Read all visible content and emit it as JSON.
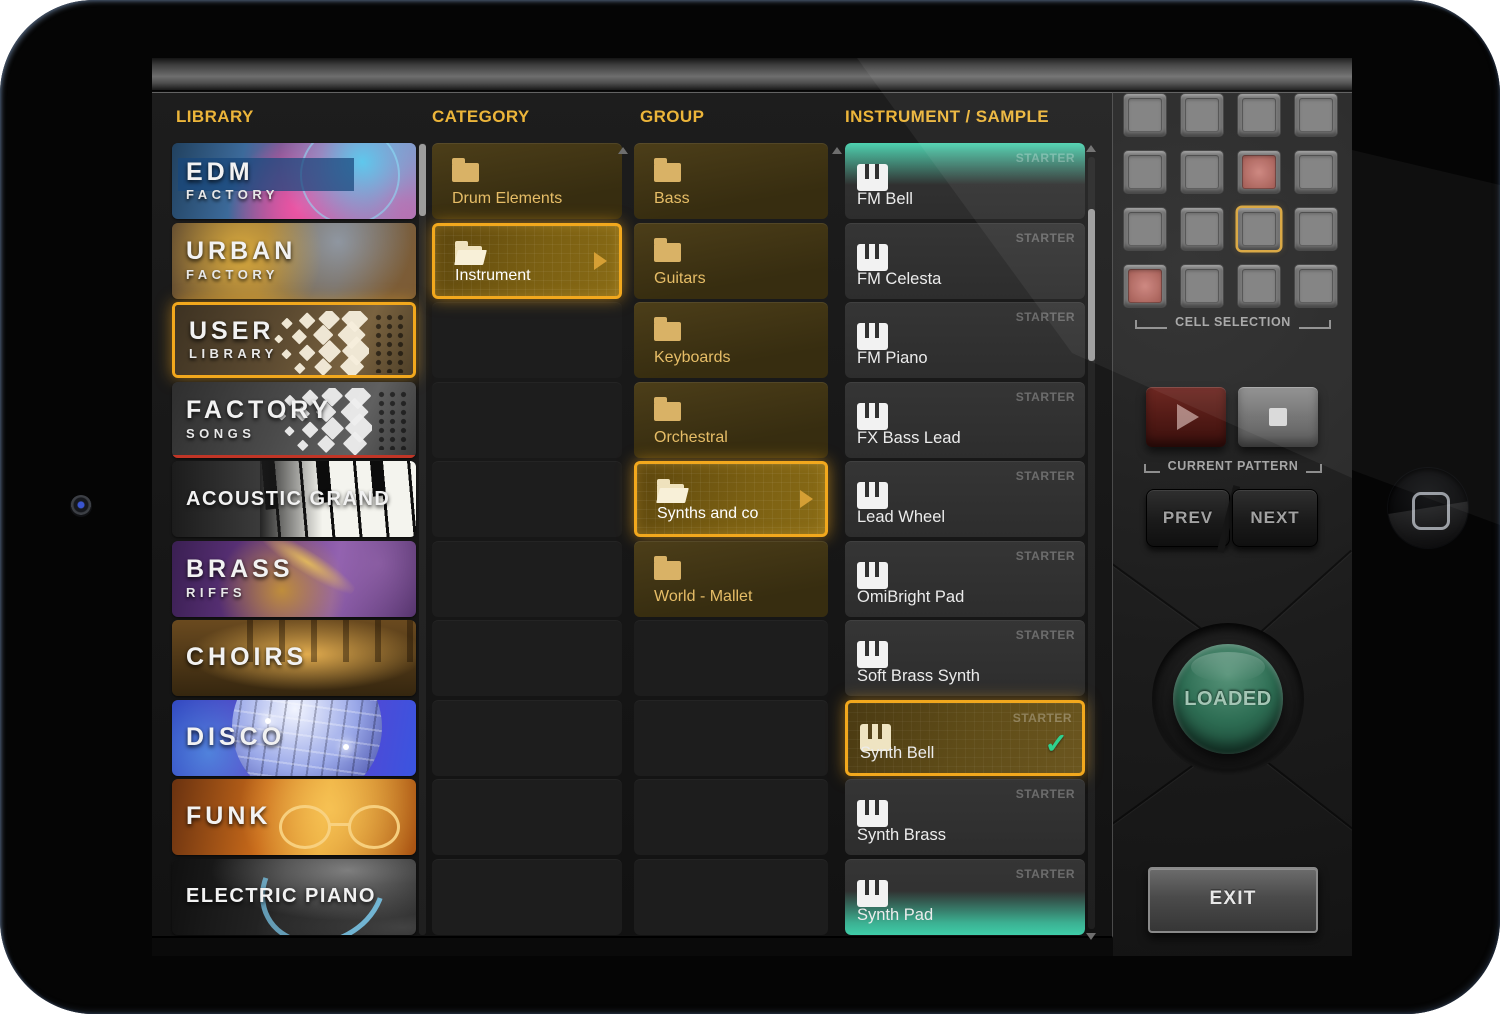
{
  "colors": {
    "accent_gold": "#ecb53a",
    "selection_orange": "#f2a81d",
    "teal_edge": "#4fd6b3",
    "check_green": "#2fd08e",
    "pad_red": "#a45a52"
  },
  "browser": {
    "library": {
      "header": "LIBRARY",
      "items": [
        {
          "title": "EDM",
          "subtitle": "FACTORY",
          "selected": false
        },
        {
          "title": "URBAN",
          "subtitle": "FACTORY",
          "selected": false
        },
        {
          "title": "USER",
          "subtitle": "LIBRARY",
          "selected": true
        },
        {
          "title": "FACTORY",
          "subtitle": "SONGS",
          "selected": false
        },
        {
          "title": "ACOUSTIC GRAND",
          "selected": false
        },
        {
          "title": "BRASS",
          "subtitle": "RIFFS",
          "selected": false
        },
        {
          "title": "CHOIRS",
          "selected": false
        },
        {
          "title": "DISCO",
          "selected": false
        },
        {
          "title": "FUNK",
          "selected": false
        },
        {
          "title": "ELECTRIC PIANO",
          "selected": false
        }
      ]
    },
    "category": {
      "header": "CATEGORY",
      "items": [
        {
          "label": "Drum Elements",
          "selected": false
        },
        {
          "label": "Instrument",
          "selected": true
        }
      ]
    },
    "group": {
      "header": "GROUP",
      "items": [
        {
          "label": "Bass",
          "selected": false
        },
        {
          "label": "Guitars",
          "selected": false
        },
        {
          "label": "Keyboards",
          "selected": false
        },
        {
          "label": "Orchestral",
          "selected": false
        },
        {
          "label": "Synths and co",
          "selected": true
        },
        {
          "label": "World - Mallet",
          "selected": false
        }
      ]
    },
    "instrument": {
      "header": "INSTRUMENT / SAMPLE",
      "badge": "STARTER",
      "items": [
        {
          "label": "FM Bell",
          "selected": false
        },
        {
          "label": "FM Celesta",
          "selected": false
        },
        {
          "label": "FM Piano",
          "selected": false
        },
        {
          "label": "FX Bass Lead",
          "selected": false
        },
        {
          "label": "Lead Wheel",
          "selected": false
        },
        {
          "label": "OmiBright Pad",
          "selected": false
        },
        {
          "label": "Soft Brass Synth",
          "selected": false
        },
        {
          "label": "Synth Bell",
          "selected": true,
          "checked": true
        },
        {
          "label": "Synth Brass",
          "selected": false
        },
        {
          "label": "Synth Pad",
          "selected": false
        }
      ]
    }
  },
  "panel": {
    "cell_selection_label": "CELL SELECTION",
    "current_pattern_label": "CURRENT PATTERN",
    "prev_label": "PREV",
    "next_label": "NEXT",
    "loaded_label": "LOADED",
    "exit_label": "EXIT",
    "pads": {
      "rows": 4,
      "cols": 4,
      "lit_red": [
        [
          1,
          2
        ],
        [
          3,
          0
        ]
      ],
      "selected": [
        2,
        2
      ]
    }
  }
}
